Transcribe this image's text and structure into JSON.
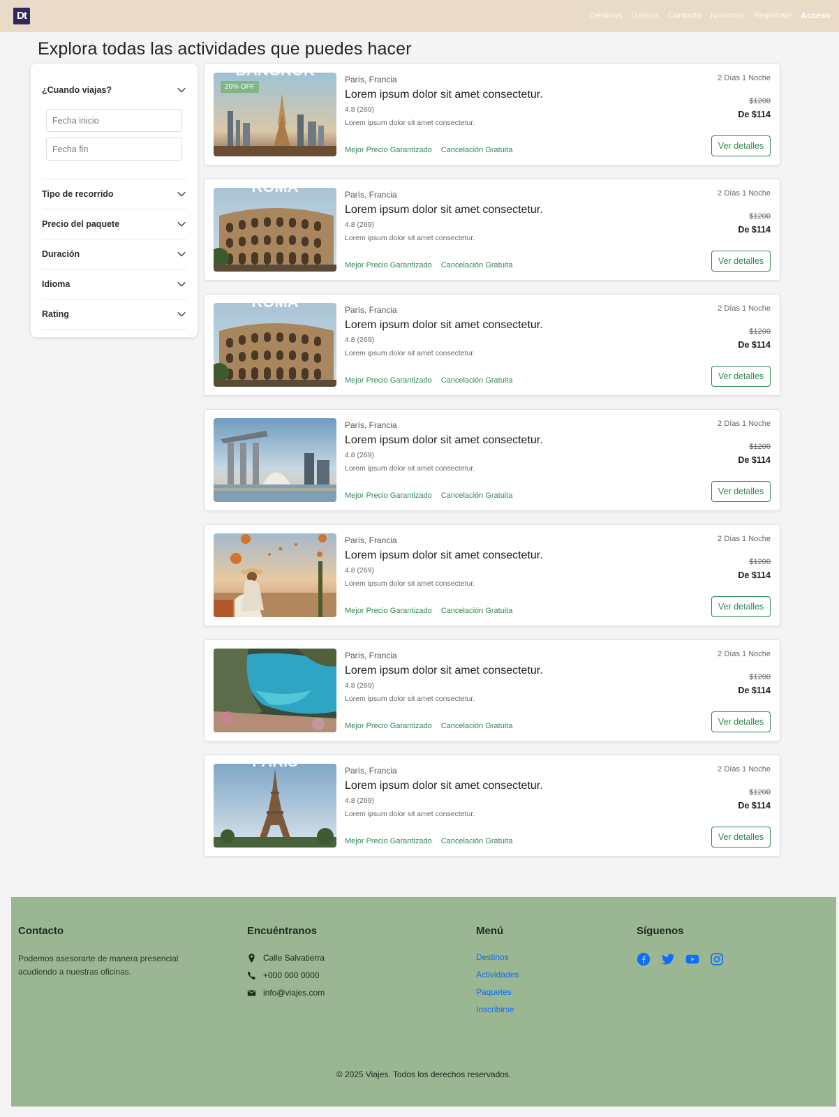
{
  "nav": {
    "logo": "Dt",
    "links": [
      "Destinos",
      "Galería",
      "Contacto",
      "Nosotros",
      "Regístrate",
      "Acceso"
    ]
  },
  "page_title": "Explora todas las actividades que puedes hacer",
  "filters": {
    "when": {
      "label": "¿Cuando viajas?",
      "start_placeholder": "Fecha inicio",
      "end_placeholder": "Fecha fin"
    },
    "others": [
      "Tipo de recorrido",
      "Precio del paquete",
      "Duración",
      "Idioma",
      "Rating"
    ]
  },
  "listings": [
    {
      "image": "bangkok",
      "image_caption": "BANGKOK",
      "badge": "20% OFF",
      "location": "París, Francia",
      "title": "Lorem ipsum dolor sit amet consectetur.",
      "rating": "4.8 (269)",
      "description": "Lorem ipsum dolor sit amet consectetur.",
      "tag1": "Mejor Precio Garantizado",
      "tag2": "Cancelación Gratuita",
      "duration": "2 Días 1 Noche",
      "old_price": "$1200",
      "price": "De $114",
      "button": "Ver detalles"
    },
    {
      "image": "colosseum",
      "image_caption": "ROMA",
      "badge": "",
      "location": "París, Francia",
      "title": "Lorem ipsum dolor sit amet consectetur.",
      "rating": "4.8 (269)",
      "description": "Lorem ipsum dolor sit amet consectetur.",
      "tag1": "Mejor Precio Garantizado",
      "tag2": "Cancelación Gratuita",
      "duration": "2 Días 1 Noche",
      "old_price": "$1200",
      "price": "De $114",
      "button": "Ver detalles"
    },
    {
      "image": "colosseum",
      "image_caption": "ROMA",
      "badge": "",
      "location": "París, Francia",
      "title": "Lorem ipsum dolor sit amet consectetur.",
      "rating": "4.8 (269)",
      "description": "Lorem ipsum dolor sit amet consectetur.",
      "tag1": "Mejor Precio Garantizado",
      "tag2": "Cancelación Gratuita",
      "duration": "2 Días 1 Noche",
      "old_price": "$1200",
      "price": "De $114",
      "button": "Ver detalles"
    },
    {
      "image": "singapore",
      "image_caption": "",
      "badge": "",
      "location": "París, Francia",
      "title": "Lorem ipsum dolor sit amet consectetur.",
      "rating": "4.8 (269)",
      "description": "Lorem ipsum dolor sit amet consectetur.",
      "tag1": "Mejor Precio Garantizado",
      "tag2": "Cancelación Gratuita",
      "duration": "2 Días 1 Noche",
      "old_price": "$1200",
      "price": "De $114",
      "button": "Ver detalles"
    },
    {
      "image": "balloons",
      "image_caption": "",
      "badge": "",
      "location": "París, Francia",
      "title": "Lorem ipsum dolor sit amet consectetur.",
      "rating": "4.8 (269)",
      "description": "Lorem ipsum dolor sit amet consectetur.",
      "tag1": "Mejor Precio Garantizado",
      "tag2": "Cancelación Gratuita",
      "duration": "2 Días 1 Noche",
      "old_price": "$1200",
      "price": "De $114",
      "button": "Ver detalles"
    },
    {
      "image": "cove",
      "image_caption": "",
      "badge": "",
      "location": "París, Francia",
      "title": "Lorem ipsum dolor sit amet consectetur.",
      "rating": "4.8 (269)",
      "description": "Lorem ipsum dolor sit amet consectetur.",
      "tag1": "Mejor Precio Garantizado",
      "tag2": "Cancelación Gratuita",
      "duration": "2 Días 1 Noche",
      "old_price": "$1200",
      "price": "De $114",
      "button": "Ver detalles"
    },
    {
      "image": "eiffel",
      "image_caption": "PARIS",
      "badge": "",
      "location": "París, Francia",
      "title": "Lorem ipsum dolor sit amet consectetur.",
      "rating": "4.8 (269)",
      "description": "Lorem ipsum dolor sit amet consectetur.",
      "tag1": "Mejor Precio Garantizado",
      "tag2": "Cancelación Gratuita",
      "duration": "2 Días 1 Noche",
      "old_price": "$1200",
      "price": "De $114",
      "button": "Ver detalles"
    }
  ],
  "footer": {
    "contact": {
      "title": "Contacto",
      "text": "Podemos asesorarte de manera presencial acudiendo a nuestras oficinas."
    },
    "find_us": {
      "title": "Encuéntranos",
      "address": "Calle Salvatierra",
      "phone": "+000 000 0000",
      "email": "info@viajes.com"
    },
    "menu": {
      "title": "Menú",
      "links": [
        "Destinos",
        "Actividades",
        "Paquetes",
        "Inscribirse"
      ]
    },
    "follow": {
      "title": "Síguenos",
      "icons": [
        "facebook-icon",
        "twitter-icon",
        "youtube-icon",
        "instagram-icon"
      ]
    },
    "copyright": "© 2025 Viajes. Todos los derechos reservados."
  },
  "colors": {
    "navbar_bg": "#e9dbc8",
    "footer_bg": "#9bb692",
    "accent_green": "#2e8a52",
    "link_blue": "#0d6efd",
    "social_blue": "#0d6efd"
  }
}
